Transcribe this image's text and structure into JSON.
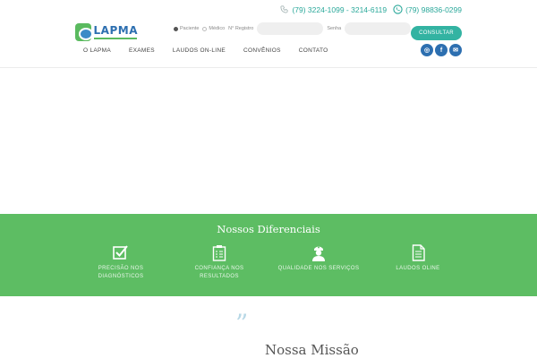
{
  "header": {
    "phone": "(79) 3224-1099 - 3214-6119",
    "whatsapp": "(79) 98836-0299",
    "logo_name": "LAPMA",
    "login": {
      "option_patient": "Paciente",
      "option_doctor": "Médico",
      "registro_label": "N° Registro",
      "senha_label": "Senha",
      "consult_button": "CONSULTAR"
    },
    "nav": [
      "O LAPMA",
      "EXAMES",
      "LAUDOS ON-LINE",
      "CONVÊNIOS",
      "CONTATO"
    ],
    "social": [
      {
        "name": "instagram-icon",
        "glyph": "◎"
      },
      {
        "name": "facebook-icon",
        "glyph": "f"
      },
      {
        "name": "email-icon",
        "glyph": "✉"
      }
    ]
  },
  "differentials": {
    "title": "Nossos Diferenciais",
    "items": [
      {
        "line1": "PRECISÃO NOS",
        "line2": "DIAGNÓSTICOS",
        "icon": "checkbox-icon"
      },
      {
        "line1": "CONFIANÇA NOS",
        "line2": "RESULTADOS",
        "icon": "clipboard-icon"
      },
      {
        "line1": "QUALIDADE NOS SERVIÇOS",
        "line2": "",
        "icon": "nurse-icon"
      },
      {
        "line1": "LAUDOS OLINE",
        "line2": "",
        "icon": "document-icon"
      }
    ]
  },
  "mission": {
    "quote": "”",
    "title": "Nossa Missão"
  },
  "colors": {
    "teal": "#33b3a2",
    "green": "#5dbd63",
    "blue": "#2d6fb0"
  }
}
